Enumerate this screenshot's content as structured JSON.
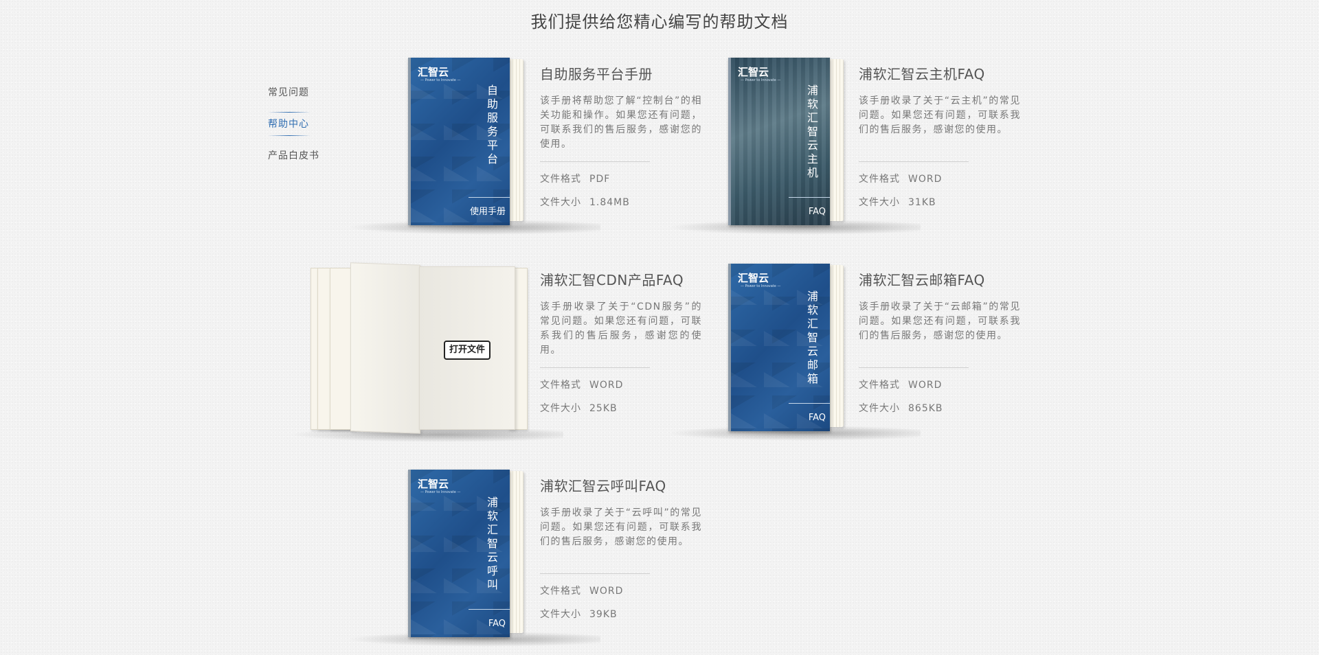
{
  "page": {
    "title": "我们提供给您精心编写的帮助文档"
  },
  "nav": {
    "items": [
      {
        "label": "常见问题",
        "active": false
      },
      {
        "label": "帮助中心",
        "active": true
      },
      {
        "label": "产品白皮书",
        "active": false
      }
    ]
  },
  "labels": {
    "format": "文件格式",
    "size": "文件大小",
    "open_file": "打开文件"
  },
  "cover_brand": {
    "logo": "汇智云",
    "tagline": "— Power to Innovate —"
  },
  "docs": [
    {
      "title": "自助服务平台手册",
      "desc": "该手册将帮助您了解“控制台”的相关功能和操作。如果您还有问题，可联系我们的售后服务，感谢您的使用。",
      "format": "PDF",
      "size": "1.84MB",
      "cover_title": "自助服务平台",
      "cover_foot": "使用手册",
      "cover_style": "blue"
    },
    {
      "title": "浦软汇智云主机FAQ",
      "desc": "该手册收录了关于“云主机”的常见问题。如果您还有问题，可联系我们的售后服务，感谢您的使用。",
      "format": "WORD",
      "size": "31KB",
      "cover_title": "浦软汇智云主机",
      "cover_foot": "FAQ",
      "cover_style": "photo"
    },
    {
      "title": "浦软汇智CDN产品FAQ",
      "desc": "该手册收录了关于“CDN服务”的常见问题。如果您还有问题，可联系我们的售后服务，感谢您的使用。",
      "format": "WORD",
      "size": "25KB",
      "cover_title": "",
      "cover_foot": "",
      "cover_style": "open"
    },
    {
      "title": "浦软汇智云邮箱FAQ",
      "desc": "该手册收录了关于“云邮箱”的常见问题。如果您还有问题，可联系我们的售后服务，感谢您的使用。",
      "format": "WORD",
      "size": "865KB",
      "cover_title": "浦软汇智云邮箱",
      "cover_foot": "FAQ",
      "cover_style": "blue"
    },
    {
      "title": "浦软汇智云呼叫FAQ",
      "desc": "该手册收录了关于“云呼叫”的常见问题。如果您还有问题，可联系我们的售后服务，感谢您的使用。",
      "format": "WORD",
      "size": "39KB",
      "cover_title": "浦软汇智云呼叫",
      "cover_foot": "FAQ",
      "cover_style": "blue"
    }
  ]
}
